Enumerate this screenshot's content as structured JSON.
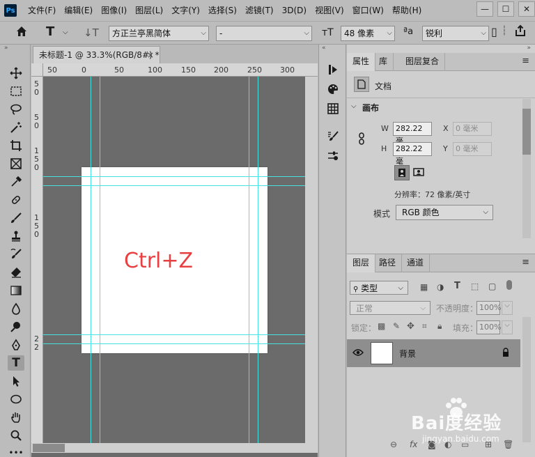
{
  "app": {
    "logo": "Ps",
    "menu": [
      "文件(F)",
      "编辑(E)",
      "图像(I)",
      "图层(L)",
      "文字(Y)",
      "选择(S)",
      "滤镜(T)",
      "3D(D)",
      "视图(V)",
      "窗口(W)",
      "帮助(H)"
    ],
    "window_controls": [
      "—",
      "☐",
      "✕"
    ]
  },
  "options": {
    "font_family": "方正兰亭黑简体",
    "font_style": "-",
    "font_size": "48 像素",
    "aa_label": "ªa",
    "antialias": "锐利"
  },
  "document": {
    "tab_title": "未标题-1 @ 33.3%(RGB/8#) *",
    "close": "×",
    "canvas_text": "Ctrl+Z",
    "ruler_top": [
      "50",
      "0",
      "50",
      "100",
      "150",
      "200",
      "250",
      "300"
    ],
    "ruler_left": [
      "5",
      "0",
      "5",
      "0",
      "1",
      "5",
      "0",
      "1",
      "5",
      "0",
      "2",
      "2"
    ]
  },
  "properties": {
    "tabs": [
      "属性",
      "库",
      "图层复合"
    ],
    "doc_label": "文档",
    "canvas_section": "画布",
    "w_label": "W",
    "w_value": "282.22 毫",
    "h_label": "H",
    "h_value": "282.22 毫",
    "x_label": "X",
    "x_value": "0 毫米",
    "y_label": "Y",
    "y_value": "0 毫米",
    "resolution": "分辨率：72 像素/英寸",
    "mode_label": "模式",
    "mode_value": "RGB 颜色"
  },
  "layers": {
    "tabs": [
      "图层",
      "路径",
      "通道"
    ],
    "filter_label": "类型",
    "blend_mode": "正常",
    "opacity_label": "不透明度：",
    "opacity_value": "100%",
    "lock_label": "锁定：",
    "fill_label": "填充：",
    "fill_value": "100%",
    "layer_name": "背景"
  },
  "watermark": {
    "text": "Bai度经验",
    "url": "jingyan.baidu.com"
  }
}
